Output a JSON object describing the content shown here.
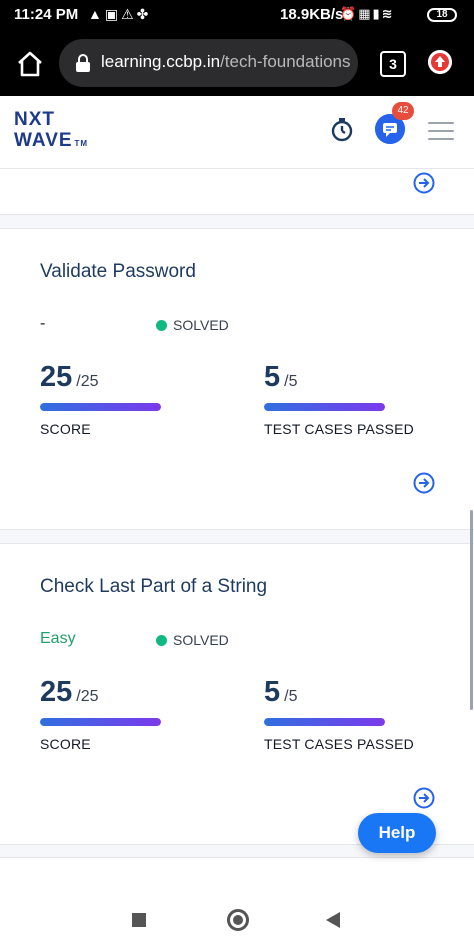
{
  "status_bar": {
    "time": "11:24 PM",
    "network_speed": "18.9KB/s",
    "battery": "18",
    "left_icons": [
      "navigation-icon",
      "gallery-icon",
      "alert-icon",
      "fan-icon"
    ],
    "right_icons": [
      "alarm-icon",
      "volte-icon",
      "signal-icon",
      "wifi-icon",
      "battery-icon"
    ]
  },
  "browser": {
    "url_domain": "learning.ccbp.in",
    "url_path": "/tech-foundations",
    "tab_count": "3"
  },
  "header": {
    "logo_line1": "NXT",
    "logo_line2": "WAVE",
    "logo_tm": "TM",
    "notification_count": "42"
  },
  "problems": [
    {
      "title": "Validate Password",
      "difficulty": "-",
      "status": "SOLVED",
      "score": "25",
      "score_total": "/25",
      "score_label": "SCORE",
      "score_progress": 1.0,
      "tests": "5",
      "tests_total": "/5",
      "tests_label": "TEST CASES PASSED",
      "tests_progress": 1.0
    },
    {
      "title": "Check Last Part of a String",
      "difficulty": "Easy",
      "status": "SOLVED",
      "score": "25",
      "score_total": "/25",
      "score_label": "SCORE",
      "score_progress": 1.0,
      "tests": "5",
      "tests_total": "/5",
      "tests_label": "TEST CASES PASSED",
      "tests_progress": 1.0
    }
  ],
  "colors": {
    "difficulty_easy": "#22a06b",
    "difficulty_none": "#111827",
    "solved_dot": "#10b981",
    "accent": "#1976f5"
  },
  "help": {
    "label": "Help"
  }
}
